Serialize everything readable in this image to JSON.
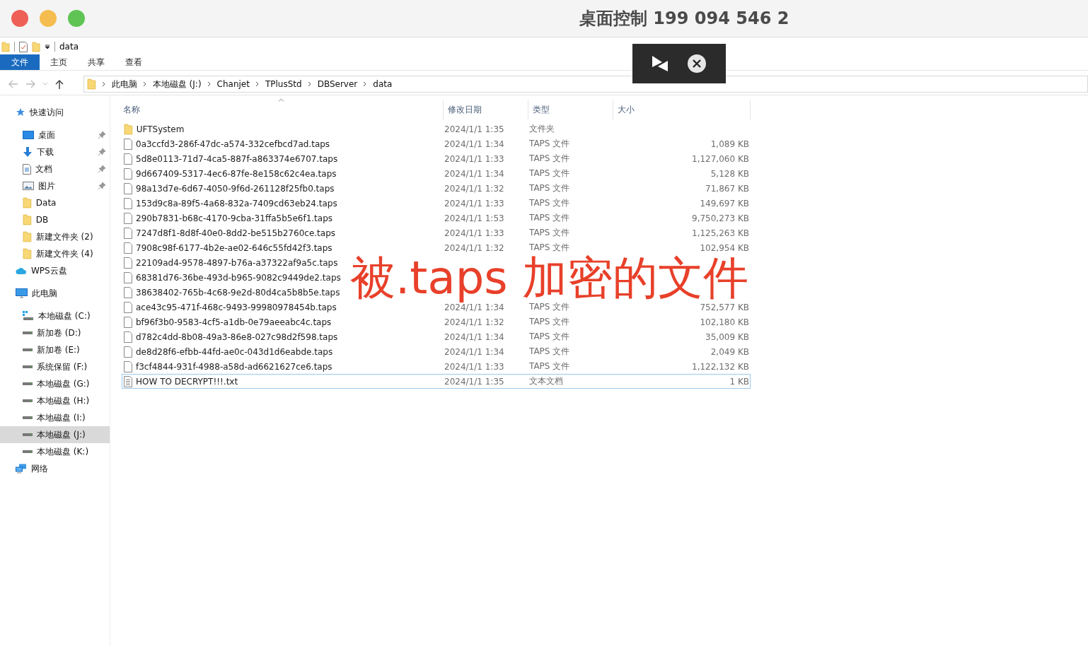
{
  "window": {
    "title": "桌面控制 199 094 546 2"
  },
  "explorer": {
    "title": "data",
    "ribbon_tabs": [
      {
        "label": "文件",
        "selected": true
      },
      {
        "label": "主页",
        "selected": false
      },
      {
        "label": "共享",
        "selected": false
      },
      {
        "label": "查看",
        "selected": false
      }
    ],
    "breadcrumb": [
      "此电脑",
      "本地磁盘 (J:)",
      "Chanjet",
      "TPlusStd",
      "DBServer",
      "data"
    ],
    "sidebar": [
      {
        "label": "快速访问",
        "kind": "star",
        "selected": false,
        "children": [
          {
            "label": "桌面",
            "kind": "desktop",
            "pinned": true,
            "selected": false
          },
          {
            "label": "下载",
            "kind": "download",
            "pinned": true,
            "selected": false
          },
          {
            "label": "文档",
            "kind": "document",
            "pinned": true,
            "selected": false
          },
          {
            "label": "图片",
            "kind": "pictures",
            "pinned": true,
            "selected": false
          },
          {
            "label": "Data",
            "kind": "folder",
            "pinned": false,
            "selected": false
          },
          {
            "label": "DB",
            "kind": "folder",
            "pinned": false,
            "selected": false
          },
          {
            "label": "新建文件夹 (2)",
            "kind": "folder",
            "pinned": false,
            "selected": false
          },
          {
            "label": "新建文件夹 (4)",
            "kind": "folder",
            "pinned": false,
            "selected": false
          }
        ]
      },
      {
        "label": "WPS云盘",
        "kind": "cloud",
        "selected": false
      },
      {
        "label": "此电脑",
        "kind": "pc",
        "selected": false,
        "children": [
          {
            "label": "本地磁盘 (C:)",
            "kind": "system-drive",
            "selected": false
          },
          {
            "label": "新加卷 (D:)",
            "kind": "drive",
            "selected": false
          },
          {
            "label": "新加卷 (E:)",
            "kind": "drive",
            "selected": false
          },
          {
            "label": "系统保留 (F:)",
            "kind": "drive",
            "selected": false
          },
          {
            "label": "本地磁盘 (G:)",
            "kind": "drive",
            "selected": false
          },
          {
            "label": "本地磁盘 (H:)",
            "kind": "drive",
            "selected": false
          },
          {
            "label": "本地磁盘 (I:)",
            "kind": "drive",
            "selected": false
          },
          {
            "label": "本地磁盘 (J:)",
            "kind": "drive",
            "selected": true
          },
          {
            "label": "本地磁盘 (K:)",
            "kind": "drive",
            "selected": false
          }
        ]
      },
      {
        "label": "网络",
        "kind": "network",
        "selected": false
      }
    ],
    "columns": [
      "名称",
      "修改日期",
      "类型",
      "大小"
    ],
    "files": [
      {
        "name": "UFTSystem",
        "kind": "folder",
        "date": "2024/1/1 1:35",
        "type": "文件夹",
        "focused": false
      },
      {
        "name": "0a3ccfd3-286f-47dc-a574-332cefbcd7ad.taps",
        "kind": "file",
        "date": "2024/1/1 1:34",
        "type": "TAPS 文件",
        "size": "1,089 KB",
        "focused": false
      },
      {
        "name": "5d8e0113-71d7-4ca5-887f-a863374e6707.taps",
        "kind": "file",
        "date": "2024/1/1 1:33",
        "type": "TAPS 文件",
        "size": "1,127,060 KB",
        "focused": false
      },
      {
        "name": "9d667409-5317-4ec6-87fe-8e158c62c4ea.taps",
        "kind": "file",
        "date": "2024/1/1 1:34",
        "type": "TAPS 文件",
        "size": "5,128 KB",
        "focused": false
      },
      {
        "name": "98a13d7e-6d67-4050-9f6d-261128f25fb0.taps",
        "kind": "file",
        "date": "2024/1/1 1:32",
        "type": "TAPS 文件",
        "size": "71,867 KB",
        "focused": false
      },
      {
        "name": "153d9c8a-89f5-4a68-832a-7409cd63eb24.taps",
        "kind": "file",
        "date": "2024/1/1 1:33",
        "type": "TAPS 文件",
        "size": "149,697 KB",
        "focused": false
      },
      {
        "name": "290b7831-b68c-4170-9cba-31ffa5b5e6f1.taps",
        "kind": "file",
        "date": "2024/1/1 1:53",
        "type": "TAPS 文件",
        "size": "9,750,273 KB",
        "focused": false
      },
      {
        "name": "7247d8f1-8d8f-40e0-8dd2-be515b2760ce.taps",
        "kind": "file",
        "date": "2024/1/1 1:33",
        "type": "TAPS 文件",
        "size": "1,125,263 KB",
        "focused": false
      },
      {
        "name": "7908c98f-6177-4b2e-ae02-646c55fd42f3.taps",
        "kind": "file",
        "date": "2024/1/1 1:32",
        "type": "TAPS 文件",
        "size": "102,954 KB",
        "focused": false
      },
      {
        "name": "22109ad4-9578-4897-b76a-a37322af9a5c.taps",
        "kind": "file",
        "focused": false
      },
      {
        "name": "68381d76-36be-493d-b965-9082c9449de2.taps",
        "kind": "file",
        "focused": false
      },
      {
        "name": "38638402-765b-4c68-9e2d-80d4ca5b8b5e.taps",
        "kind": "file",
        "focused": false
      },
      {
        "name": "ace43c95-471f-468c-9493-99980978454b.taps",
        "kind": "file",
        "date": "2024/1/1 1:34",
        "type": "TAPS 文件",
        "size": "752,577 KB",
        "focused": false
      },
      {
        "name": "bf96f3b0-9583-4cf5-a1db-0e79aeeabc4c.taps",
        "kind": "file",
        "date": "2024/1/1 1:32",
        "type": "TAPS 文件",
        "size": "102,180 KB",
        "focused": false
      },
      {
        "name": "d782c4dd-8b08-49a3-86e8-027c98d2f598.taps",
        "kind": "file",
        "date": "2024/1/1 1:34",
        "type": "TAPS 文件",
        "size": "35,009 KB",
        "focused": false
      },
      {
        "name": "de8d28f6-efbb-44fd-ae0c-043d1d6eabde.taps",
        "kind": "file",
        "date": "2024/1/1 1:34",
        "type": "TAPS 文件",
        "size": "2,049 KB",
        "focused": false
      },
      {
        "name": "f3cf4844-931f-4988-a58d-ad6621627ce6.taps",
        "kind": "file",
        "date": "2024/1/1 1:33",
        "type": "TAPS 文件",
        "size": "1,122,132 KB",
        "focused": false
      },
      {
        "name": "HOW TO DECRYPT!!!.txt",
        "kind": "text",
        "date": "2024/1/1 1:35",
        "type": "文本文档",
        "size": "1 KB",
        "focused": true
      }
    ]
  },
  "annotation": "被.taps 加密的文件"
}
